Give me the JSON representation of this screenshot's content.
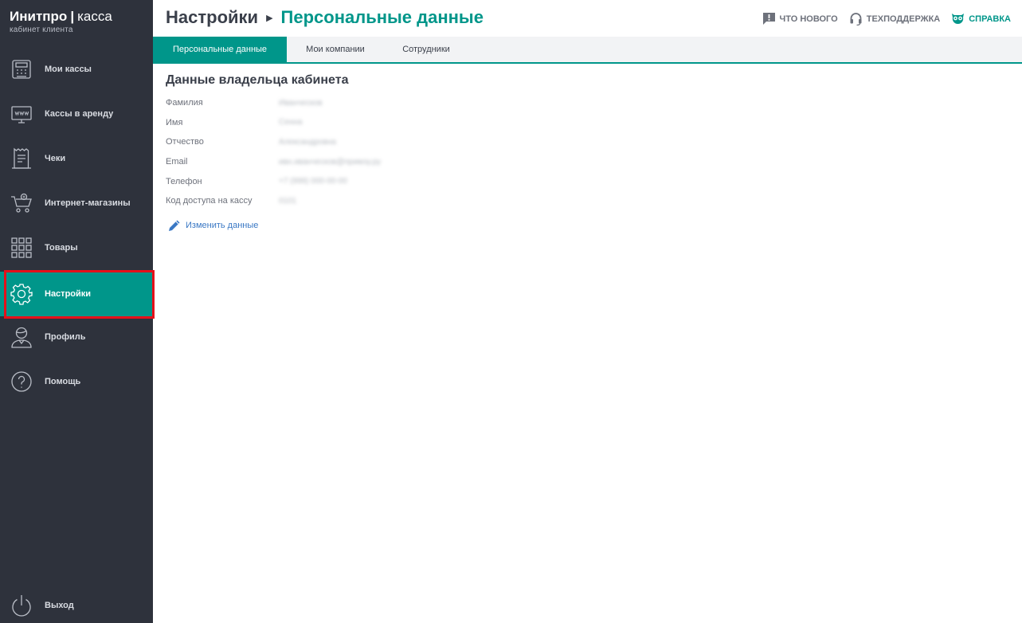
{
  "brand": {
    "name_bold": "Инитпро",
    "separator": "|",
    "name_light": "касса",
    "subtitle": "кабинет клиента"
  },
  "sidebar": {
    "items": [
      {
        "label": "Мои кассы",
        "icon": "cash-register-icon"
      },
      {
        "label": "Кассы в аренду",
        "icon": "www-monitor-icon"
      },
      {
        "label": "Чеки",
        "icon": "receipt-icon"
      },
      {
        "label": "Интернет-магазины",
        "icon": "shopping-cart-icon"
      },
      {
        "label": "Товары",
        "icon": "grid-icon"
      },
      {
        "label": "Настройки",
        "icon": "gear-icon",
        "active": true
      },
      {
        "label": "Профиль",
        "icon": "user-icon"
      },
      {
        "label": "Помощь",
        "icon": "question-icon"
      }
    ],
    "logout_label": "Выход"
  },
  "header": {
    "crumb_root": "Настройки",
    "crumb_sep": "▶",
    "crumb_current": "Персональные данные",
    "links": {
      "whats_new": "ЧТО НОВОГО",
      "support": "ТЕХПОДДЕРЖКА",
      "help": "СПРАВКА"
    }
  },
  "tabs": [
    {
      "label": "Персональные данные",
      "active": true
    },
    {
      "label": "Мои компании",
      "active": false
    },
    {
      "label": "Сотрудники",
      "active": false
    }
  ],
  "owner": {
    "title": "Данные владельца кабинета",
    "fields": [
      {
        "label": "Фамилия",
        "value": "Иванческов"
      },
      {
        "label": "Имя",
        "value": "Сенна"
      },
      {
        "label": "Отчество",
        "value": "Александровна"
      },
      {
        "label": "Email",
        "value": "ивн.иванческов@примэу.ру"
      },
      {
        "label": "Телефон",
        "value": "+7 (999) 000-00-00"
      },
      {
        "label": "Код доступа на кассу",
        "value": "0101"
      }
    ],
    "edit_label": "Изменить данные"
  },
  "colors": {
    "accent": "#00968a",
    "sidebar_bg": "#2e323c",
    "highlight_outline": "#e5101a",
    "link": "#3a78c4"
  }
}
